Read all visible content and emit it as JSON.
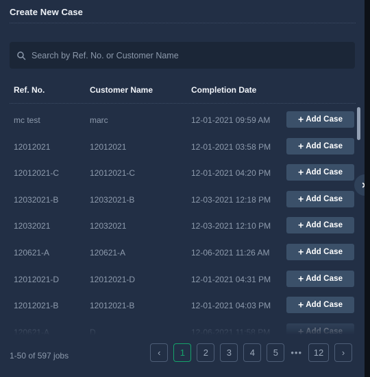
{
  "panel": {
    "title": "Create New Case",
    "close_label": "✕"
  },
  "search": {
    "icon": "search-icon",
    "value": "",
    "placeholder": "Search by Ref. No. or Customer Name"
  },
  "table": {
    "columns": [
      "Ref. No.",
      "Customer Name",
      "Completion Date",
      ""
    ],
    "action_label": "Add Case",
    "action_icon": "plus-icon",
    "rows": [
      {
        "ref": "mc test",
        "customer": "marc",
        "date": "12-01-2021 09:59 AM"
      },
      {
        "ref": "12012021",
        "customer": "12012021",
        "date": "12-01-2021 03:58 PM"
      },
      {
        "ref": "12012021-C",
        "customer": "12012021-C",
        "date": "12-01-2021 04:20 PM"
      },
      {
        "ref": "12032021-B",
        "customer": "12032021-B",
        "date": "12-03-2021 12:18 PM"
      },
      {
        "ref": "12032021",
        "customer": "12032021",
        "date": "12-03-2021 12:10 PM"
      },
      {
        "ref": "120621-A",
        "customer": "120621-A",
        "date": "12-06-2021 11:26 AM"
      },
      {
        "ref": "12012021-D",
        "customer": "12012021-D",
        "date": "12-01-2021 04:31 PM"
      },
      {
        "ref": "12012021-B",
        "customer": "12012021-B",
        "date": "12-01-2021 04:03 PM"
      },
      {
        "ref": "120621-A",
        "customer": "D",
        "date": "12-06-2021 11:58 PM"
      }
    ]
  },
  "footer": {
    "jobs_count": "1-50 of 597 jobs",
    "pagination": {
      "prev_label": "‹",
      "next_label": "›",
      "ellipsis": "•••",
      "pages": [
        "1",
        "2",
        "3",
        "4",
        "5"
      ],
      "last_page": "12",
      "active": "1"
    }
  },
  "colors": {
    "panel_bg": "#222f45",
    "search_bg": "#1b2637",
    "button_bg": "#3b5069",
    "accent_green": "#15a36b",
    "muted_text": "#8e9bad",
    "edge_dark": "#0d1117"
  }
}
